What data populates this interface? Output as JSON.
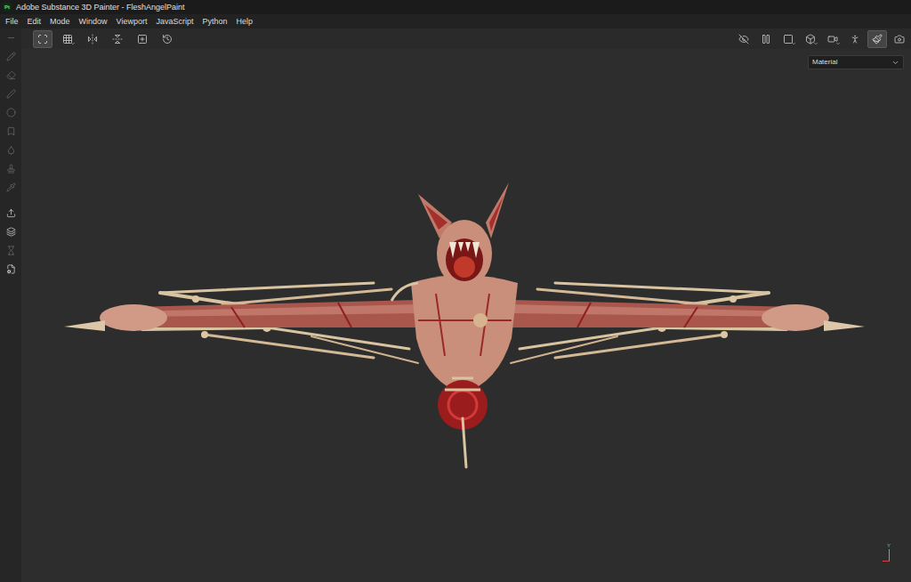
{
  "window": {
    "title": "Adobe Substance 3D Painter - FleshAngelPaint",
    "logo": "Pt"
  },
  "menu": [
    "File",
    "Edit",
    "Mode",
    "Window",
    "Viewport",
    "JavaScript",
    "Python",
    "Help"
  ],
  "toolbar_left": [
    {
      "selected": true,
      "dropdown": false
    },
    {
      "selected": false,
      "dropdown": true
    },
    {
      "selected": false,
      "dropdown": false
    },
    {
      "selected": false,
      "dropdown": false
    },
    {
      "selected": false,
      "dropdown": false
    },
    {
      "selected": false,
      "dropdown": false
    }
  ],
  "toolbar_right": [
    {
      "selected": false,
      "dropdown": false
    },
    {
      "selected": false,
      "dropdown": false
    },
    {
      "selected": false,
      "dropdown": true
    },
    {
      "selected": false,
      "dropdown": true
    },
    {
      "selected": false,
      "dropdown": true
    },
    {
      "selected": false,
      "dropdown": false
    },
    {
      "selected": true,
      "dropdown": false
    },
    {
      "selected": false,
      "dropdown": false
    }
  ],
  "tools": [
    {
      "selected": false,
      "disabled": true
    },
    {
      "selected": false,
      "disabled": true
    },
    {
      "selected": false,
      "disabled": true
    },
    {
      "selected": false,
      "disabled": true
    },
    {
      "selected": false,
      "disabled": true
    },
    {
      "selected": false,
      "disabled": true
    },
    {
      "selected": false,
      "disabled": true
    },
    {
      "selected": false,
      "disabled": true
    },
    {
      "selected": false,
      "disabled": true
    },
    {
      "selected": false,
      "disabled": false
    },
    {
      "selected": false,
      "disabled": false
    },
    {
      "selected": false,
      "disabled": true
    },
    {
      "selected": false,
      "disabled": false
    }
  ],
  "viewport": {
    "mode_dropdown": "Material",
    "axis_label": "Y"
  }
}
